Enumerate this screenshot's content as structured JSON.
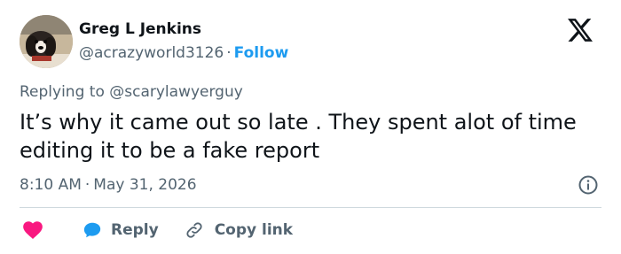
{
  "author": {
    "display_name": "Greg L Jenkins",
    "handle": "@acrazyworld3126",
    "separator": "·",
    "follow_label": "Follow"
  },
  "reply_context": {
    "prefix": "Replying to",
    "mention": "@scarylawyerguy"
  },
  "tweet": {
    "text": "It’s why it came out so late . They spent alot of time editing it to be a fake report"
  },
  "meta": {
    "time": "8:10 AM",
    "separator": "·",
    "date": "May 31, 2026"
  },
  "actions": {
    "reply_label": "Reply",
    "copy_link_label": "Copy link"
  },
  "icons": {
    "logo": "x-logo-icon",
    "info": "info-icon",
    "like": "heart-icon",
    "reply": "speech-bubble-icon",
    "copy": "link-icon"
  },
  "colors": {
    "accent": "#1d9bf0",
    "like": "#f91880",
    "muted": "#536471",
    "text": "#0f1419",
    "divider": "#cfd9de"
  }
}
